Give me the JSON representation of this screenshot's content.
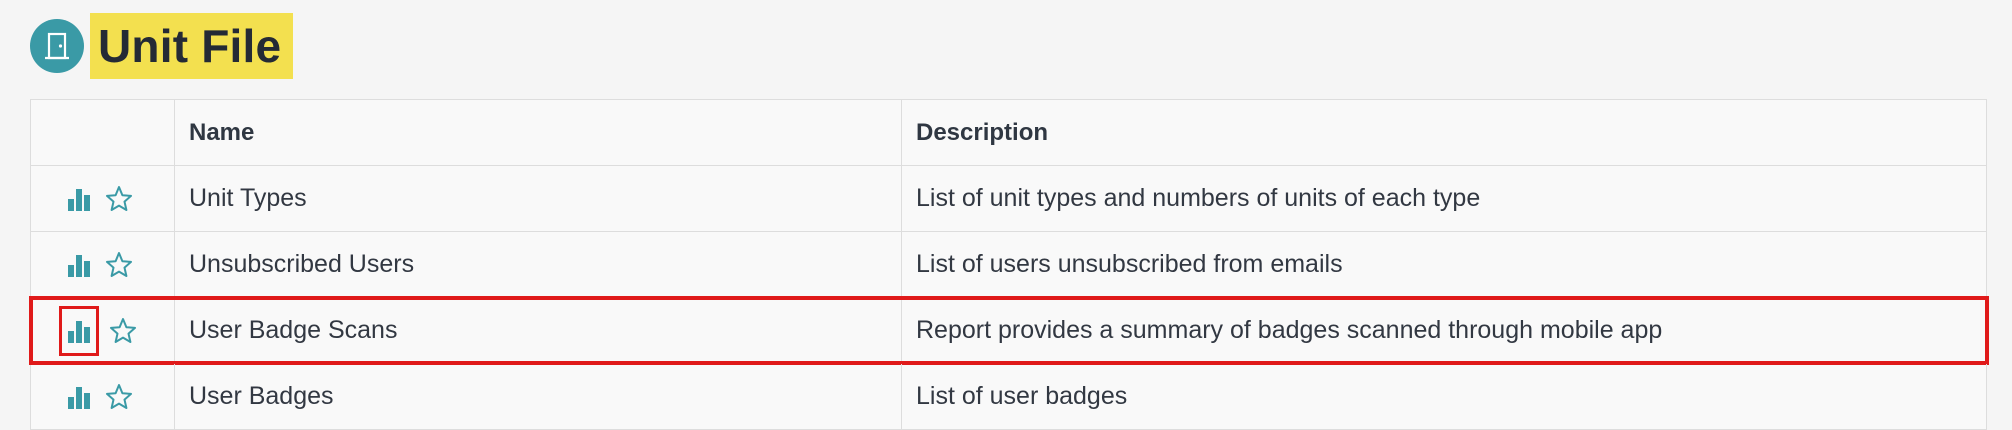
{
  "page": {
    "title": "Unit File",
    "icon": "door-icon",
    "accent_color": "#3a9aa6",
    "title_highlight_color": "#f3e04f"
  },
  "table": {
    "columns": [
      "",
      "Name",
      "Description"
    ],
    "rows": [
      {
        "name": "Unit Types",
        "description": "List of unit types and numbers of units of each type"
      },
      {
        "name": "Unsubscribed Users",
        "description": "List of users unsubscribed from emails"
      },
      {
        "name": "User Badge Scans",
        "description": "Report provides a summary of badges scanned through mobile app"
      },
      {
        "name": "User Badges",
        "description": "List of user badges"
      }
    ],
    "row_icons": [
      "bar-chart-icon",
      "star-outline-icon"
    ],
    "highlight_color": "#e01a1a"
  }
}
